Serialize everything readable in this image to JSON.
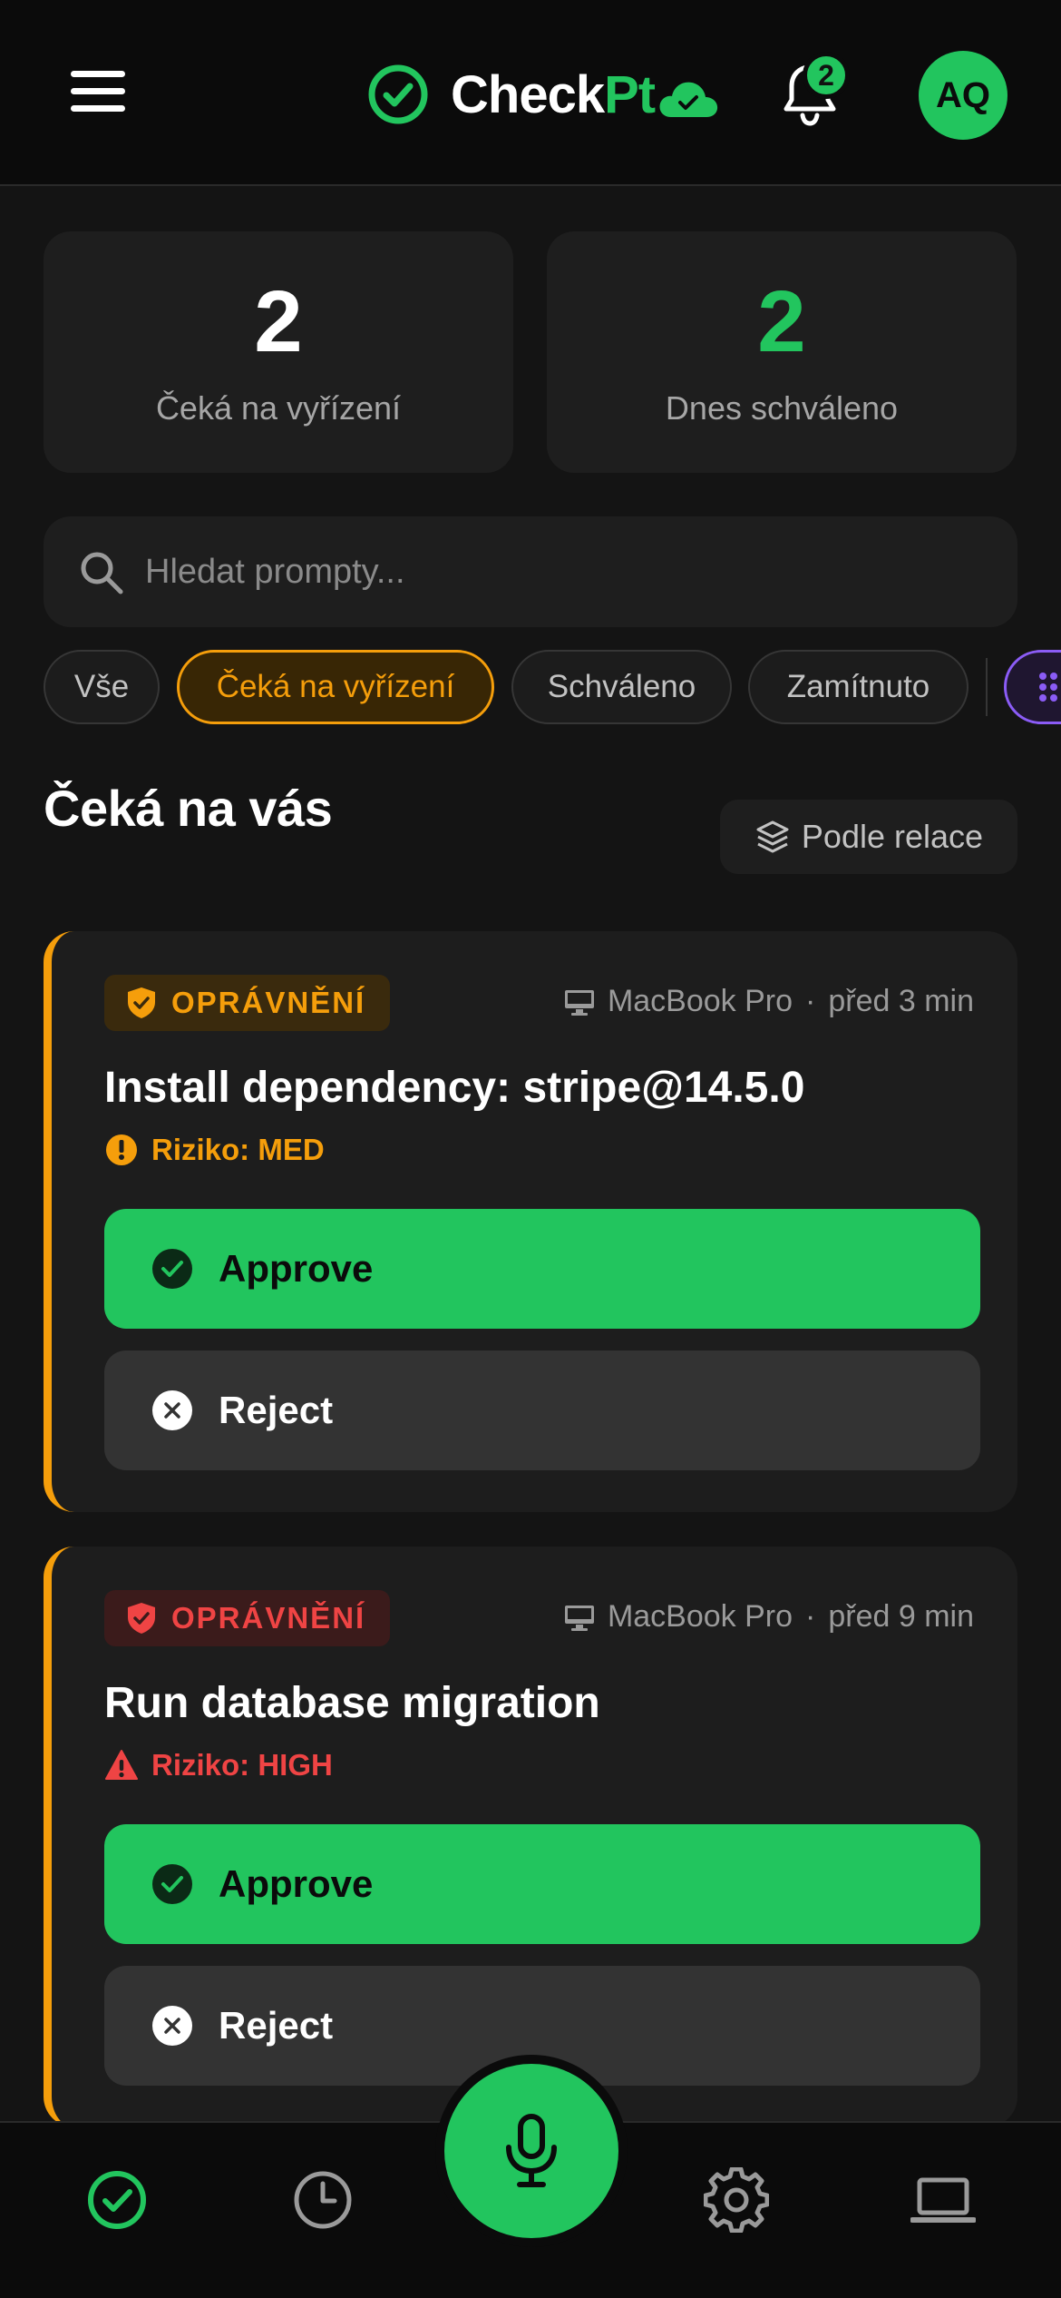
{
  "app": {
    "name_main": "Check",
    "name_accent": "Pt",
    "notification_count": "2",
    "avatar_initials": "AQ"
  },
  "stats": {
    "pending_value": "2",
    "pending_label": "Čeká na vyřízení",
    "approved_value": "2",
    "approved_label": "Dnes schváleno"
  },
  "search": {
    "placeholder": "Hledat prompty..."
  },
  "filters": [
    {
      "label": "Vše"
    },
    {
      "label": "Čeká na vyřízení",
      "active": true
    },
    {
      "label": "Schváleno"
    },
    {
      "label": "Zamítnuto"
    }
  ],
  "section": {
    "title": "Čeká na vás",
    "group_button": "Podle relace"
  },
  "requests": [
    {
      "badge": "OPRÁVNĚNÍ",
      "device": "MacBook Pro",
      "separator": "·",
      "time": "před 3 min",
      "title": "Install dependency: stripe@14.5.0",
      "risk": "Riziko: MED",
      "approve_label": "Approve",
      "reject_label": "Reject"
    },
    {
      "badge": "OPRÁVNĚNÍ",
      "device": "MacBook Pro",
      "separator": "·",
      "time": "před 9 min",
      "title": "Run database migration",
      "risk": "Riziko: HIGH",
      "approve_label": "Approve",
      "reject_label": "Reject"
    }
  ],
  "colors": {
    "accent": "#22c55e",
    "warning": "#f59e0b",
    "danger": "#ef4444",
    "purple": "#8b5cf6",
    "background": "#141414",
    "surface": "#1e1e1e"
  },
  "icons": {
    "brand": "check-circle-icon",
    "cloud": "cloud-check-icon",
    "menu": "hamburger-menu-icon",
    "bell": "bell-icon",
    "search": "search-icon",
    "layers": "layers-icon",
    "shield": "shield-check-icon",
    "monitor": "monitor-icon",
    "alert_med": "alert-circle-icon",
    "alert_high": "warning-triangle-icon",
    "approve": "check-circle-filled-icon",
    "reject": "x-circle-filled-icon",
    "nav": [
      "check-circle-icon",
      "clock-icon",
      "microphone-icon",
      "gear-icon",
      "laptop-icon"
    ]
  }
}
